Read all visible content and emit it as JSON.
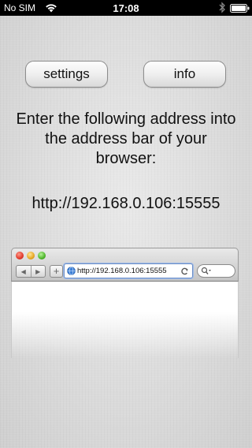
{
  "status_bar": {
    "carrier": "No SIM",
    "time": "17:08"
  },
  "buttons": {
    "settings": "settings",
    "info": "info"
  },
  "instructions": "Enter the following address into the address bar of your browser:",
  "server_address": "http://192.168.0.106:15555",
  "browser_mockup": {
    "url": "http://192.168.0.106:15555",
    "back_symbol": "◀",
    "forward_symbol": "▶",
    "add_symbol": "+"
  },
  "colors": {
    "status_bar_bg": "#000000",
    "url_focus": "#6e8fc6"
  }
}
